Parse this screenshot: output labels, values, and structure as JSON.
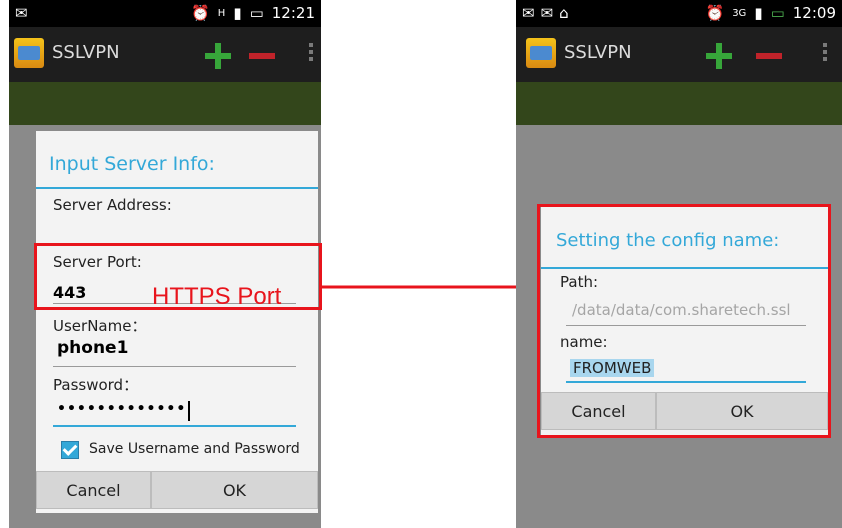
{
  "left_phone": {
    "status": {
      "time": "12:21",
      "network": "H"
    },
    "app_title": "SSLVPN",
    "dialog": {
      "title": "Input Server Info:",
      "server_address_label": "Server Address:",
      "server_port_label": "Server Port:",
      "server_port_value": "443",
      "username_label": "UserName：",
      "username_value": "phone1",
      "password_label": "Password：",
      "password_value": "•••••••••••••",
      "save_label": "Save Username and Password",
      "cancel": "Cancel",
      "ok": "OK"
    },
    "callout": "HTTPS Port"
  },
  "right_phone": {
    "status": {
      "time": "12:09",
      "network": "3G"
    },
    "app_title": "SSLVPN",
    "dialog": {
      "title": "Setting the config name:",
      "path_label": "Path:",
      "path_value": "/data/data/com.sharetech.ssl",
      "name_label": "name:",
      "name_value": "FROMWEB",
      "cancel": "Cancel",
      "ok": "OK"
    }
  },
  "colors": {
    "accent": "#33a8d8",
    "highlight": "#e8141c",
    "actionbar_green": "#33461b"
  }
}
